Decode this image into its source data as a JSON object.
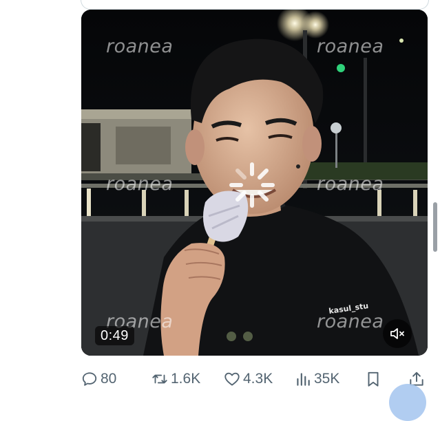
{
  "video": {
    "watermarks": [
      "roanea",
      "roanea",
      "roanea",
      "roanea",
      "roanea",
      "roanea"
    ],
    "shirt_text": "kasul_stu",
    "duration": "0:49",
    "mute_icon": "speaker-muted-icon",
    "spinner_icon": "loading-spinner-icon"
  },
  "actions": {
    "replies": {
      "icon": "reply-icon",
      "count": "80"
    },
    "reposts": {
      "icon": "repost-icon",
      "count": "1.6K"
    },
    "likes": {
      "icon": "heart-icon",
      "count": "4.3K"
    },
    "views": {
      "icon": "views-icon",
      "count": "35K"
    },
    "bookmark": {
      "icon": "bookmark-icon"
    },
    "share": {
      "icon": "share-icon"
    }
  },
  "colors": {
    "icon_gray": "#536471",
    "fab_blue": "#a9c8ef"
  }
}
